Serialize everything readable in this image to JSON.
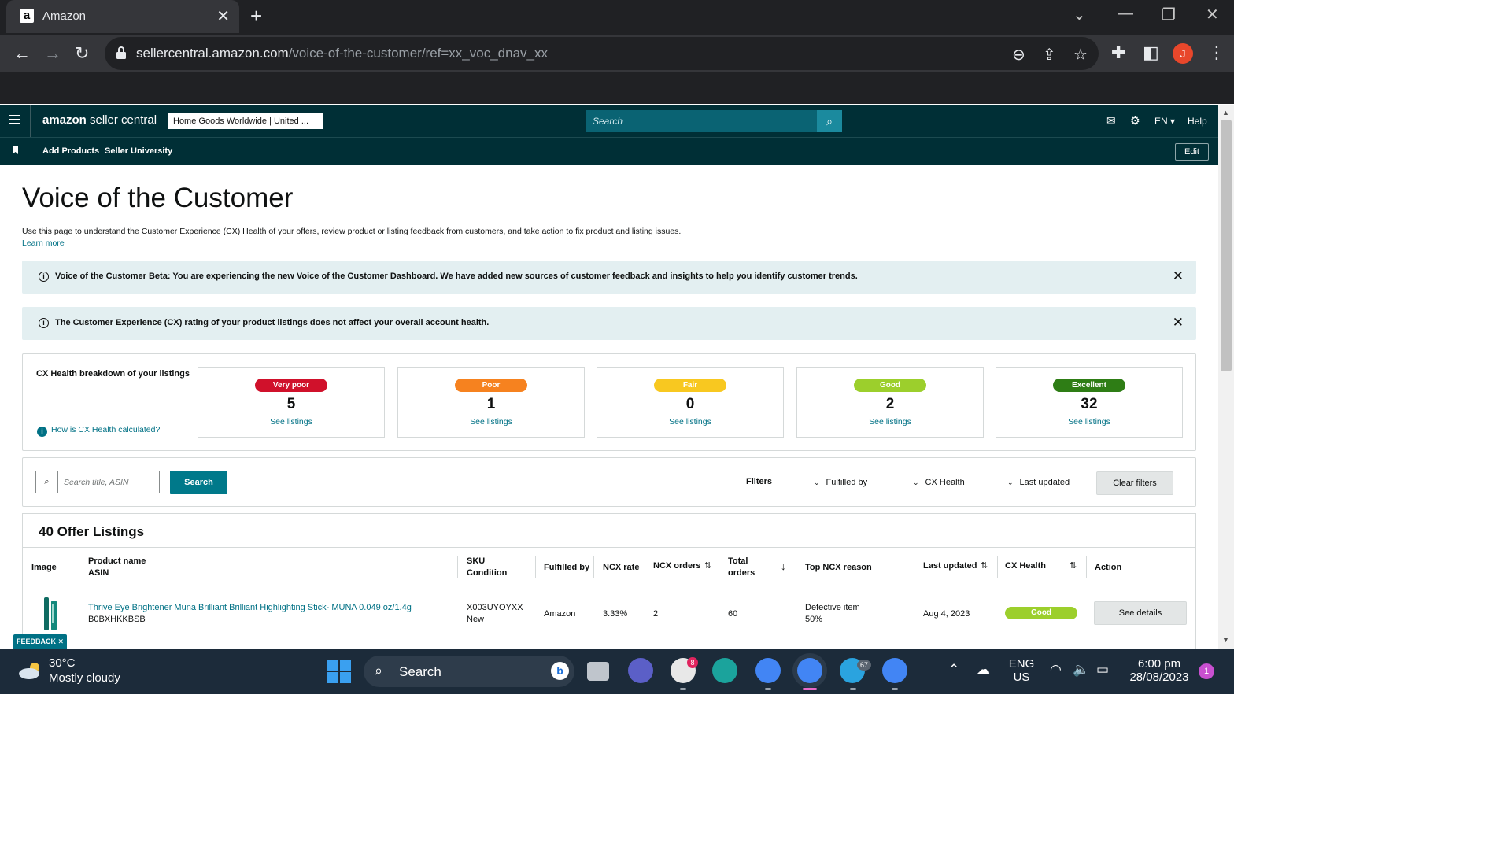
{
  "browser": {
    "tab_title": "Amazon",
    "favicon": "a",
    "url_host": "sellercentral.amazon.com",
    "url_path": "/voice-of-the-customer/ref=xx_voc_dnav_xx",
    "profile_initial": "J"
  },
  "header": {
    "logo_brand": "amazon",
    "logo_product": "seller central",
    "store_selector": "Home Goods Worldwide | United ...",
    "search_placeholder": "Search",
    "language": "EN",
    "help": "Help"
  },
  "subnav": {
    "items": [
      "Add Products",
      "Seller University"
    ],
    "edit": "Edit"
  },
  "page": {
    "title": "Voice of the Customer",
    "description": "Use this page to understand the Customer Experience (CX) Health of your offers, review product or listing feedback from customers, and take action to fix product and listing issues.",
    "learn_more": "Learn more"
  },
  "alerts": [
    "Voice of the Customer Beta: You are experiencing the new Voice of the Customer Dashboard. We have added new sources of customer feedback and insights to help you identify customer trends.",
    "The Customer Experience (CX) rating of your product listings does not affect your overall account health."
  ],
  "cx_health": {
    "label": "CX Health breakdown of your listings",
    "how_link": "How is CX Health calculated?",
    "cards": [
      {
        "status": "Very poor",
        "count": "5",
        "link": "See listings",
        "color": "#d0112b"
      },
      {
        "status": "Poor",
        "count": "1",
        "link": "See listings",
        "color": "#f6821f"
      },
      {
        "status": "Fair",
        "count": "0",
        "link": "See listings",
        "color": "#f8c820"
      },
      {
        "status": "Good",
        "count": "2",
        "link": "See listings",
        "color": "#9ccf2c"
      },
      {
        "status": "Excellent",
        "count": "32",
        "link": "See listings",
        "color": "#2e7d15"
      }
    ]
  },
  "filters": {
    "search_placeholder": "Search title, ASIN",
    "search_button": "Search",
    "label": "Filters",
    "dropdowns": [
      "Fulfilled by",
      "CX Health",
      "Last updated"
    ],
    "clear": "Clear filters"
  },
  "listings": {
    "title": "40 Offer Listings",
    "columns": {
      "image": "Image",
      "product_name": "Product name",
      "asin": "ASIN",
      "sku": "SKU",
      "condition": "Condition",
      "fulfilled_by": "Fulfilled by",
      "ncx_rate": "NCX rate",
      "ncx_orders": "NCX orders",
      "total_orders_1": "Total",
      "total_orders_2": "orders",
      "top_reason": "Top NCX reason",
      "last_updated": "Last updated",
      "cx_health": "CX Health",
      "action": "Action"
    },
    "rows": [
      {
        "product_name": "Thrive Eye Brightener Muna Brilliant Brilliant Highlighting Stick- MUNA 0.049 oz/1.4g",
        "asin": "B0BXHKKBSB",
        "sku": "X003UYOYXX",
        "condition": "New",
        "fulfilled_by": "Amazon",
        "ncx_rate": "3.33%",
        "ncx_orders": "2",
        "total_orders": "60",
        "top_reason": "Defective item",
        "top_reason_pct": "50%",
        "last_updated": "Aug 4, 2023",
        "cx_health": "Good",
        "action": "See details"
      }
    ],
    "feedback": "FEEDBACK ✕"
  },
  "taskbar": {
    "temperature": "30°C",
    "weather": "Mostly cloudy",
    "search": "Search",
    "slack_badge": "8",
    "telegram_badge": "67",
    "lang_1": "ENG",
    "lang_2": "US",
    "time": "6:00 pm",
    "date": "28/08/2023",
    "notifications": "1"
  }
}
